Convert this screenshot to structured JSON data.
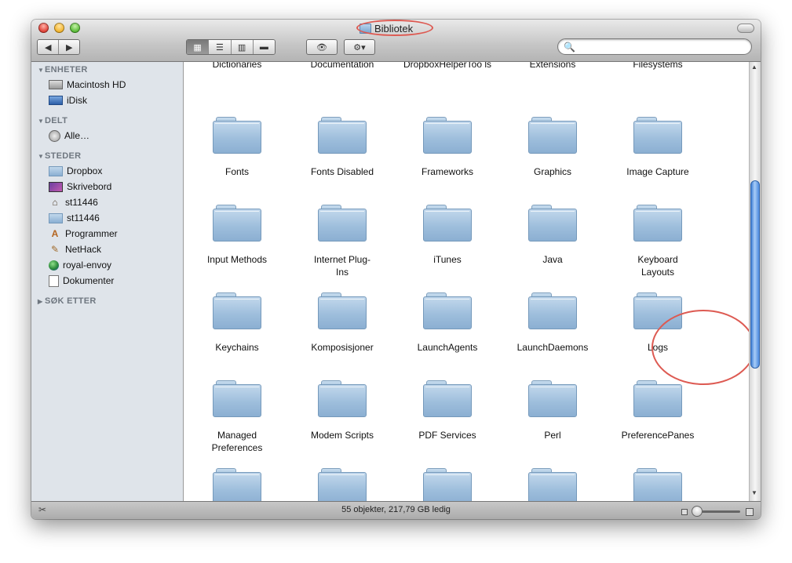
{
  "window": {
    "title": "Bibliotek",
    "status": "55 objekter, 217,79 GB ledig"
  },
  "toolbar": {
    "back": "◀",
    "forward": "▶",
    "view_icon": "▦",
    "view_list": "☰",
    "view_columns": "▥",
    "view_coverflow": "▬",
    "quicklook": "👁",
    "action": "⚙▾",
    "search_placeholder": ""
  },
  "sidebar": {
    "sections": [
      {
        "label": "ENHETER",
        "items": [
          {
            "label": "Macintosh HD",
            "icon": "hard-drive-icon"
          },
          {
            "label": "iDisk",
            "icon": "idisk-icon"
          }
        ]
      },
      {
        "label": "DELT",
        "items": [
          {
            "label": "Alle…",
            "icon": "network-icon"
          }
        ]
      },
      {
        "label": "STEDER",
        "items": [
          {
            "label": "Dropbox",
            "icon": "folder-icon"
          },
          {
            "label": "Skrivebord",
            "icon": "desktop-icon"
          },
          {
            "label": "st11446",
            "icon": "home-icon"
          },
          {
            "label": "st11446",
            "icon": "folder-icon"
          },
          {
            "label": "Programmer",
            "icon": "applications-icon"
          },
          {
            "label": "NetHack",
            "icon": "app-icon"
          },
          {
            "label": "royal-envoy",
            "icon": "globe-icon"
          },
          {
            "label": "Dokumenter",
            "icon": "document-icon"
          }
        ]
      },
      {
        "label": "SØK ETTER",
        "items": []
      }
    ]
  },
  "content": {
    "top_row": [
      "Dictionaries",
      "Documentation",
      "DropboxHelperToo ls",
      "Extensions",
      "Filesystems"
    ],
    "rows": [
      [
        "Fonts",
        "Fonts Disabled",
        "Frameworks",
        "Graphics",
        "Image Capture"
      ],
      [
        "Input Methods",
        "Internet Plug-Ins",
        "iTunes",
        "Java",
        "Keyboard Layouts"
      ],
      [
        "Keychains",
        "Komposisjoner",
        "LaunchAgents",
        "LaunchDaemons",
        "Logs"
      ],
      [
        "Managed Preferences",
        "Modem Scripts",
        "PDF Services",
        "Perl",
        "PreferencePanes"
      ]
    ]
  }
}
